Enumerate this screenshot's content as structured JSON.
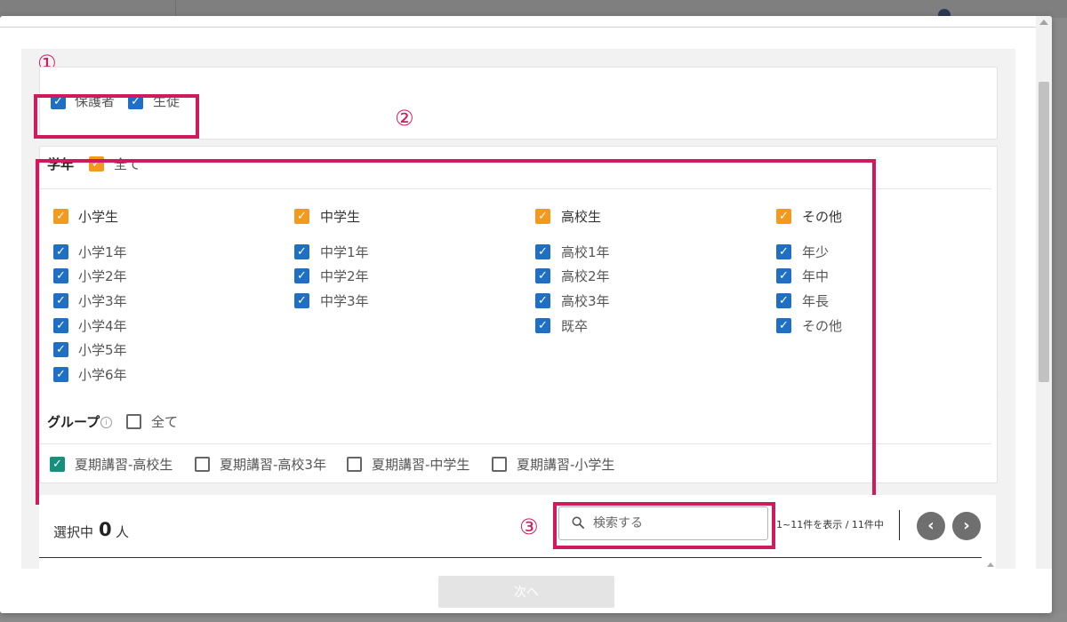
{
  "markers": {
    "one": "①",
    "two": "②",
    "three": "③"
  },
  "recipients": [
    {
      "label": "保護者",
      "checked": true
    },
    {
      "label": "生徒",
      "checked": true
    }
  ],
  "grade": {
    "title": "学年",
    "all_label": "全て",
    "columns": [
      {
        "label": "小学生",
        "items": [
          "小学1年",
          "小学2年",
          "小学3年",
          "小学4年",
          "小学5年",
          "小学6年"
        ]
      },
      {
        "label": "中学生",
        "items": [
          "中学1年",
          "中学2年",
          "中学3年"
        ]
      },
      {
        "label": "高校生",
        "items": [
          "高校1年",
          "高校2年",
          "高校3年",
          "既卒"
        ]
      },
      {
        "label": "その他",
        "items": [
          "年少",
          "年中",
          "年長",
          "その他"
        ]
      }
    ]
  },
  "group": {
    "title": "グループ",
    "info_icon": "info-icon",
    "all_label": "全て",
    "items": [
      {
        "label": "夏期講習-高校生",
        "checked": true
      },
      {
        "label": "夏期講習-高校3年",
        "checked": false
      },
      {
        "label": "夏期講習-中学生",
        "checked": false
      },
      {
        "label": "夏期講習-小学生",
        "checked": false
      }
    ]
  },
  "selection": {
    "label": "選択中",
    "count": "0",
    "unit": "人"
  },
  "search": {
    "placeholder": "検索する",
    "icon": "search-icon"
  },
  "pagination": {
    "range_text": "1~11件を表示 / 11件中",
    "prev": "‹",
    "next": "›"
  },
  "footer": {
    "next_label": "次へ"
  },
  "colors": {
    "highlight": "#d1195e",
    "checkbox_blue": "#1f6fc4",
    "checkbox_orange": "#f39a1e",
    "checkbox_teal": "#14907b"
  }
}
